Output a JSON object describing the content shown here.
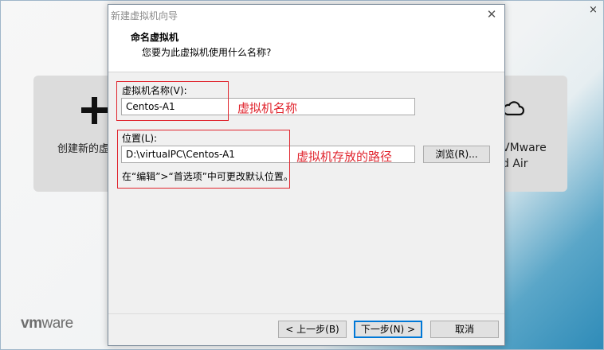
{
  "background": {
    "create_card_label": "创建新的虚",
    "cloud_card_label_line1": "VMware",
    "cloud_card_label_line2": "d Air",
    "brand_logo_vm": "vm",
    "brand_logo_ware": "ware",
    "close_glyph": "×"
  },
  "dialog": {
    "title": "新建虚拟机向导",
    "close_glyph": "✕",
    "header_title": "命名虚拟机",
    "header_subtitle": "您要为此虚拟机使用什么名称?",
    "vm_name": {
      "label": "虚拟机名称(V):",
      "value": "Centos-A1",
      "annotation": "虚拟机名称"
    },
    "location": {
      "label": "位置(L):",
      "value": "D:\\virtualPC\\Centos-A1",
      "annotation": "虚拟机存放的路径",
      "browse_label": "浏览(R)...",
      "hint": "在“编辑”>“首选项”中可更改默认位置。"
    },
    "buttons": {
      "back": "< 上一步(B)",
      "next": "下一步(N) >",
      "cancel": "取消"
    }
  },
  "colors": {
    "annotation_red": "#e0252e",
    "default_button_border": "#0078d7"
  }
}
